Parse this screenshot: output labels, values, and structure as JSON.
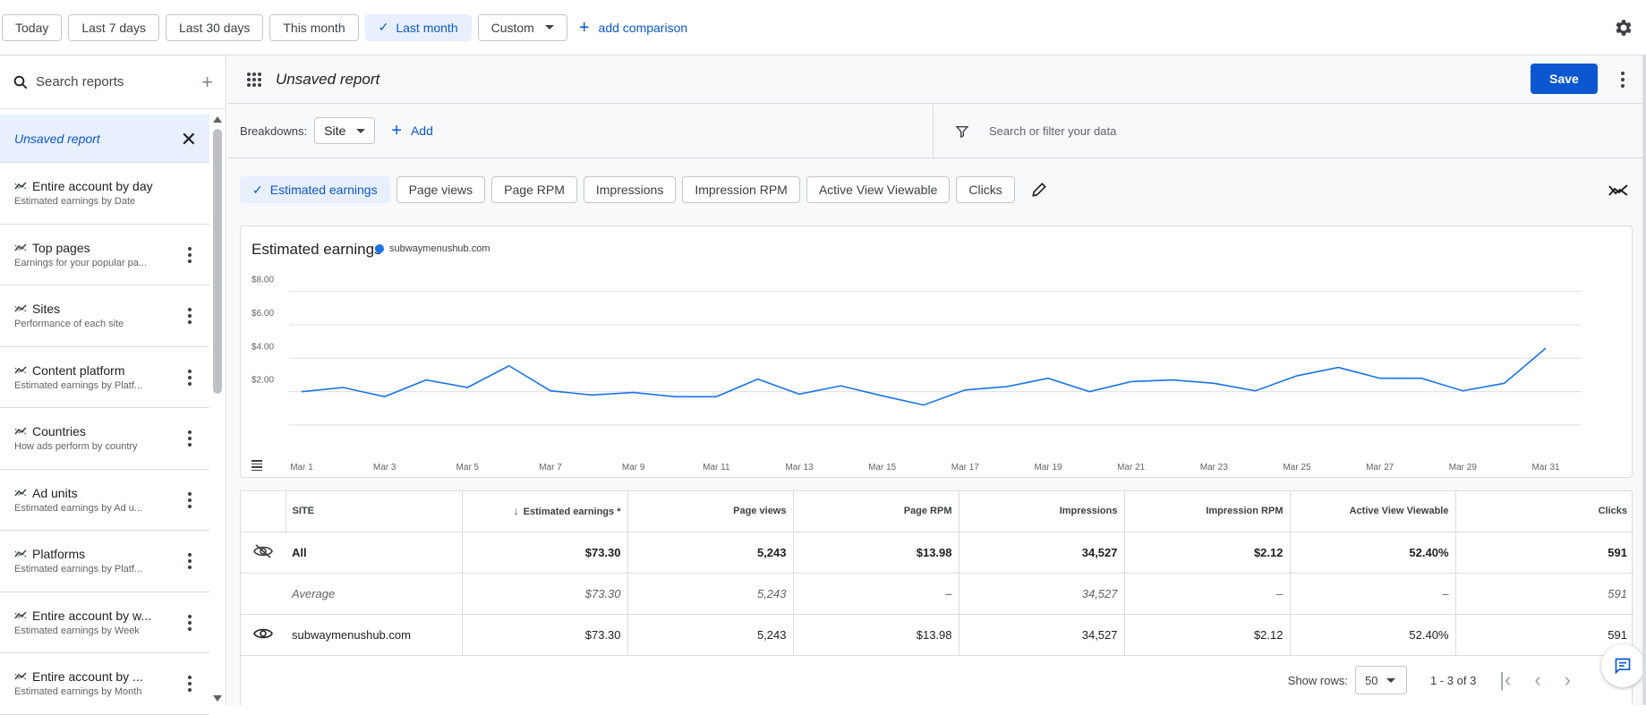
{
  "date_filters": [
    {
      "label": "Today",
      "active": false
    },
    {
      "label": "Last 7 days",
      "active": false
    },
    {
      "label": "Last 30 days",
      "active": false
    },
    {
      "label": "This month",
      "active": false
    },
    {
      "label": "Last month",
      "active": true
    },
    {
      "label": "Custom",
      "active": false
    }
  ],
  "add_comparison": "add comparison",
  "sidebar": {
    "search_placeholder": "Search reports",
    "selected": "Unsaved report",
    "items": [
      {
        "title": "Entire account by day",
        "desc": "Estimated earnings by Date"
      },
      {
        "title": "Top pages",
        "desc": "Earnings for your popular pa..."
      },
      {
        "title": "Sites",
        "desc": "Performance of each site"
      },
      {
        "title": "Content platform",
        "desc": "Estimated earnings by Platf..."
      },
      {
        "title": "Countries",
        "desc": "How ads perform by country"
      },
      {
        "title": "Ad units",
        "desc": "Estimated earnings by Ad u..."
      },
      {
        "title": "Platforms",
        "desc": "Estimated earnings by Platf..."
      },
      {
        "title": "Entire account by w...",
        "desc": "Estimated earnings by Week"
      },
      {
        "title": "Entire account by ...",
        "desc": "Estimated earnings by Month"
      }
    ]
  },
  "header": {
    "title": "Unsaved report",
    "save": "Save"
  },
  "breakdowns": {
    "label": "Breakdowns:",
    "value": "Site",
    "add": "Add",
    "filter_placeholder": "Search or filter your data"
  },
  "metrics": [
    {
      "label": "Estimated earnings",
      "active": true
    },
    {
      "label": "Page views",
      "active": false
    },
    {
      "label": "Page RPM",
      "active": false
    },
    {
      "label": "Impressions",
      "active": false
    },
    {
      "label": "Impression RPM",
      "active": false
    },
    {
      "label": "Active View Viewable",
      "active": false
    },
    {
      "label": "Clicks",
      "active": false
    }
  ],
  "chart_data": {
    "type": "line",
    "title": "Estimated earnings",
    "ylim": [
      0,
      9
    ],
    "y_ticks": [
      "$2.00",
      "$4.00",
      "$6.00",
      "$8.00"
    ],
    "x_tick_labels": [
      "Mar 1",
      "Mar 3",
      "Mar 5",
      "Mar 7",
      "Mar 9",
      "Mar 11",
      "Mar 13",
      "Mar 15",
      "Mar 17",
      "Mar 19",
      "Mar 21",
      "Mar 23",
      "Mar 25",
      "Mar 27",
      "Mar 29",
      "Mar 31"
    ],
    "grid": true,
    "series": [
      {
        "name": "subwaymenushub.com",
        "color": "#1a73e8",
        "values": [
          2.0,
          2.25,
          1.7,
          2.7,
          2.25,
          3.55,
          2.05,
          1.8,
          1.95,
          1.7,
          1.7,
          2.75,
          1.85,
          2.35,
          1.75,
          1.2,
          2.1,
          2.3,
          2.8,
          2.0,
          2.6,
          2.7,
          2.5,
          2.05,
          2.95,
          3.45,
          2.8,
          2.8,
          2.05,
          2.5,
          4.6
        ]
      }
    ]
  },
  "table": {
    "columns": [
      "SITE",
      "Estimated earnings *",
      "Page views",
      "Page RPM",
      "Impressions",
      "Impression RPM",
      "Active View Viewable",
      "Clicks"
    ],
    "rows": [
      {
        "kind": "all",
        "cells": [
          "All",
          "$73.30",
          "5,243",
          "$13.98",
          "34,527",
          "$2.12",
          "52.40%",
          "591"
        ]
      },
      {
        "kind": "avg",
        "cells": [
          "Average",
          "$73.30",
          "5,243",
          "–",
          "34,527",
          "–",
          "–",
          "591"
        ]
      },
      {
        "kind": "site",
        "cells": [
          "subwaymenushub.com",
          "$73.30",
          "5,243",
          "$13.98",
          "34,527",
          "$2.12",
          "52.40%",
          "591"
        ]
      }
    ]
  },
  "pager": {
    "show_rows_label": "Show rows:",
    "rows_value": "50",
    "range": "1 - 3 of 3"
  }
}
